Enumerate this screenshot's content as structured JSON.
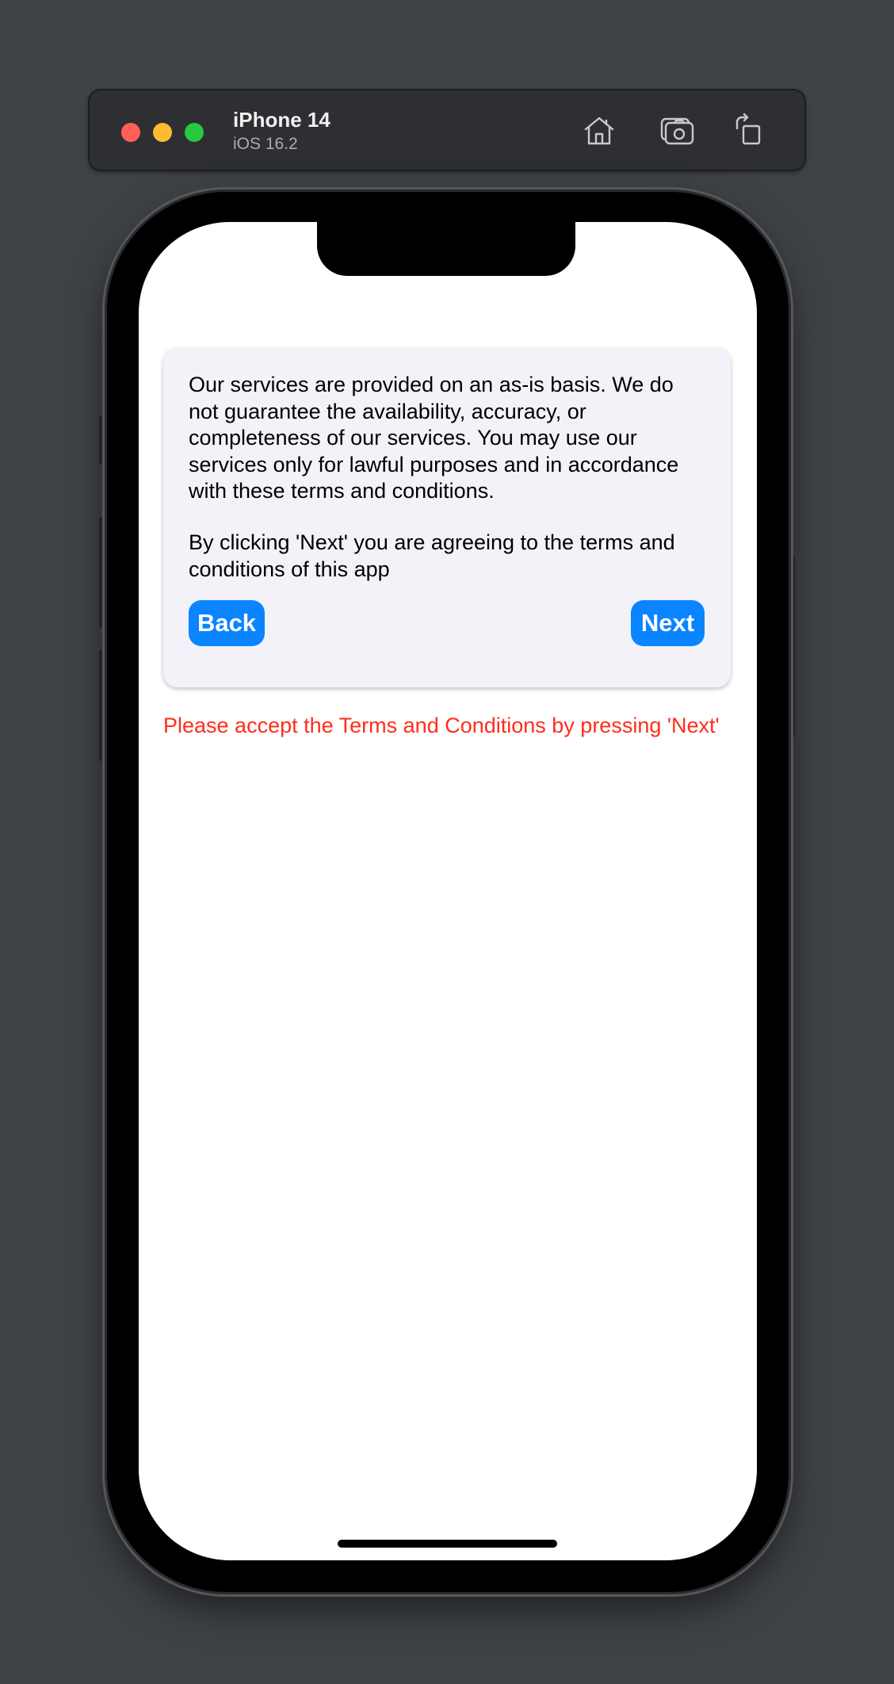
{
  "simulator": {
    "device_name": "iPhone 14",
    "os_version": "iOS 16.2",
    "icons": [
      "home-icon",
      "screenshot-camera-icon",
      "rotate-icon"
    ]
  },
  "terms": {
    "body": "Our services are provided on an as-is basis. We do not guarantee the availability, accuracy, or completeness of our services. You may use our services only for lawful purposes and in accordance with these terms and conditions.",
    "agreement": "By clicking 'Next' you are agreeing to the terms and conditions of this app",
    "back_label": "Back",
    "next_label": "Next"
  },
  "warning": "Please accept the Terms and Conditions by pressing 'Next'",
  "colors": {
    "accent": "#0a84ff",
    "warning": "#ff2d1a",
    "card_background": "#f3f2f8"
  }
}
